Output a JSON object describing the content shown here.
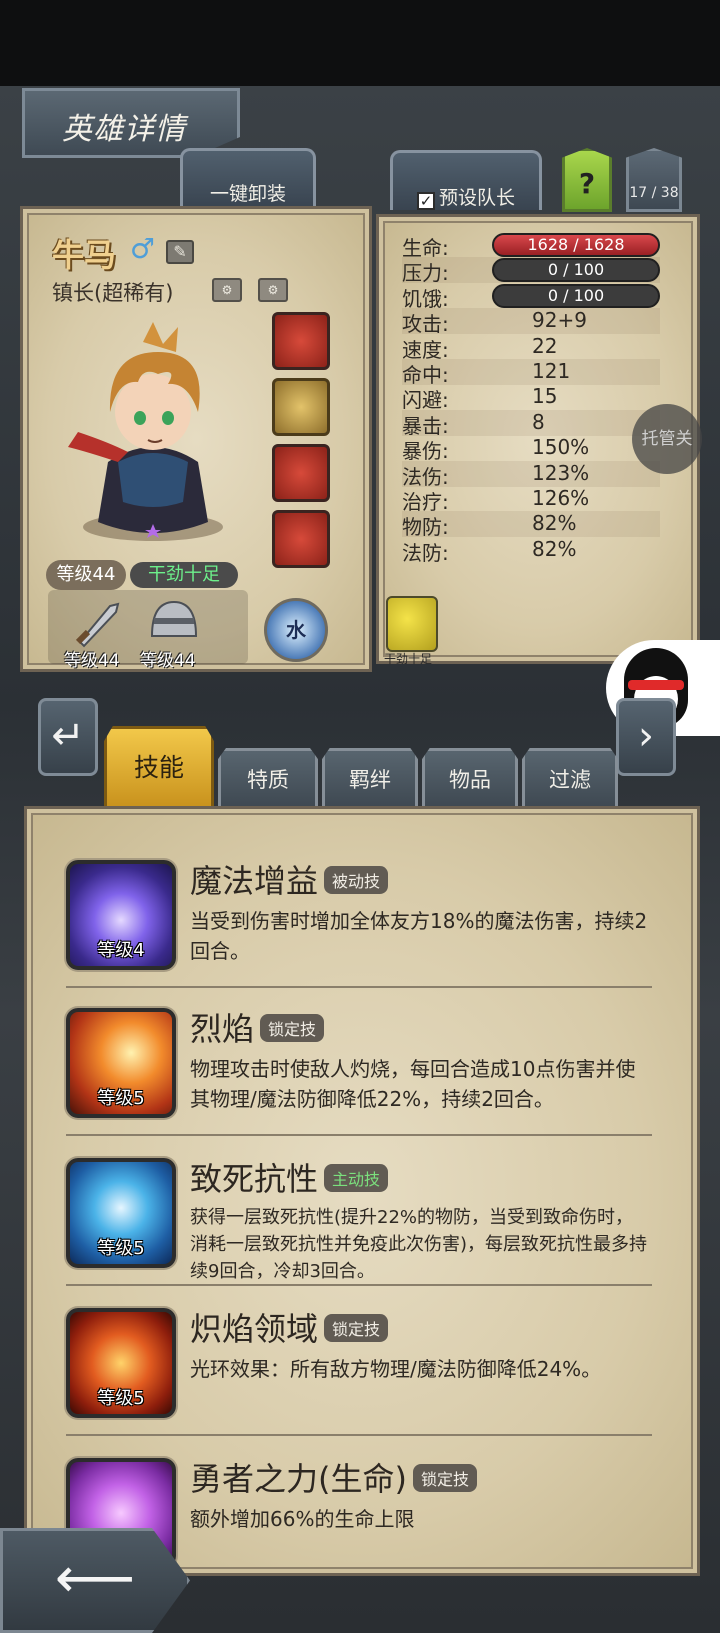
{
  "header": {
    "title": "英雄详情",
    "unequip_all": "一键卸装",
    "preset_captain": "预设队长",
    "preset_checked": "✓",
    "help": "?",
    "page_counter": "17 / 38"
  },
  "hero": {
    "name": "牛马",
    "gender_symbol": "♂",
    "title": "镇长(超稀有)",
    "level": "等级44",
    "mood": "干劲十足",
    "weapon_level": "等级44",
    "armor_level": "等级44",
    "element": "水"
  },
  "stats": [
    {
      "label": "生命:",
      "value": "1628 / 1628",
      "kind": "bar",
      "bar_color": "#c23a3d",
      "fill": 1.0
    },
    {
      "label": "压力:",
      "value": "0 / 100",
      "kind": "bar",
      "bar_color": "#3c3c3c",
      "fill": 0.0
    },
    {
      "label": "饥饿:",
      "value": "0 / 100",
      "kind": "bar",
      "bar_color": "#3c3c3c",
      "fill": 0.0
    },
    {
      "label": "攻击:",
      "value": "92+9",
      "kind": "text"
    },
    {
      "label": "速度:",
      "value": "22",
      "kind": "text"
    },
    {
      "label": "命中:",
      "value": "121",
      "kind": "text"
    },
    {
      "label": "闪避:",
      "value": "15",
      "kind": "text"
    },
    {
      "label": "暴击:",
      "value": "8",
      "kind": "text"
    },
    {
      "label": "暴伤:",
      "value": "150%",
      "kind": "text"
    },
    {
      "label": "法伤:",
      "value": "123%",
      "kind": "text"
    },
    {
      "label": "治疗:",
      "value": "126%",
      "kind": "text"
    },
    {
      "label": "物防:",
      "value": "82%",
      "kind": "text"
    },
    {
      "label": "法防:",
      "value": "82%",
      "kind": "text"
    }
  ],
  "trait_label": "干劲十足",
  "auto_button": "托管关",
  "tabs": [
    {
      "label": "技能",
      "active": true
    },
    {
      "label": "特质",
      "active": false
    },
    {
      "label": "羁绊",
      "active": false
    },
    {
      "label": "物品",
      "active": false
    },
    {
      "label": "过滤",
      "active": false
    }
  ],
  "skills": [
    {
      "name": "魔法增益",
      "type": "被动技",
      "level": "等级4",
      "desc": "当受到伤害时增加全体友方18%的魔法伤害，持续2回合。"
    },
    {
      "name": "烈焰",
      "type": "锁定技",
      "level": "等级5",
      "desc": "物理攻击时使敌人灼烧，每回合造成10点伤害并使其物理/魔法防御降低22%，持续2回合。"
    },
    {
      "name": "致死抗性",
      "type": "主动技",
      "level": "等级5",
      "desc": "获得一层致死抗性(提升22%的物防，当受到致命伤时，消耗一层致死抗性并免疫此次伤害)，每层致死抗性最多持续9回合，冷却3回合。"
    },
    {
      "name": "炽焰领域",
      "type": "锁定技",
      "level": "等级5",
      "desc": "光环效果：所有敌方物理/魔法防御降低24%。"
    },
    {
      "name": "勇者之力(生命)",
      "type": "锁定技",
      "level": "",
      "desc": "额外增加66%的生命上限"
    }
  ]
}
